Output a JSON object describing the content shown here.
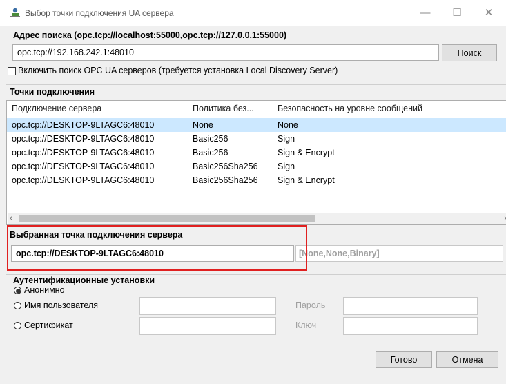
{
  "window": {
    "title": "Выбор точки подключения UA сервера",
    "minimize": "—",
    "maximize": "☐",
    "close": "✕"
  },
  "search": {
    "label": "Адрес поиска (opc.tcp://localhost:55000,opc.tcp://127.0.0.1:55000)",
    "value": "opc.tcp://192.168.242.1:48010",
    "button": "Поиск",
    "discovery_checkbox_label": "Включить поиск OPC UA серверов (требуется установка Local Discovery Server)",
    "discovery_checked": false
  },
  "endpoints": {
    "title": "Точки подключения",
    "columns": [
      "Подключение сервера",
      "Политика без...",
      "Безопасность на уровне сообщений"
    ],
    "rows": [
      [
        "opc.tcp://DESKTOP-9LTAGC6:48010",
        "None",
        "None"
      ],
      [
        "opc.tcp://DESKTOP-9LTAGC6:48010",
        "Basic256",
        "Sign"
      ],
      [
        "opc.tcp://DESKTOP-9LTAGC6:48010",
        "Basic256",
        "Sign & Encrypt"
      ],
      [
        "opc.tcp://DESKTOP-9LTAGC6:48010",
        "Basic256Sha256",
        "Sign"
      ],
      [
        "opc.tcp://DESKTOP-9LTAGC6:48010",
        "Basic256Sha256",
        "Sign & Encrypt"
      ]
    ],
    "selected_row": 0
  },
  "selected_endpoint": {
    "title": "Выбранная точка подключения сервера",
    "value": "opc.tcp://DESKTOP-9LTAGC6:48010",
    "info": "[None,None,Binary]"
  },
  "auth": {
    "title": "Аутентификационные установки",
    "anonymous": "Анонимно",
    "username": "Имя пользователя",
    "password": "Пароль",
    "certificate": "Сертификат",
    "key": "Ключ",
    "selected": "anonymous"
  },
  "buttons": {
    "ok": "Готово",
    "cancel": "Отмена"
  },
  "colors": {
    "selection": "#cce8ff",
    "highlight_box": "#e02020"
  }
}
